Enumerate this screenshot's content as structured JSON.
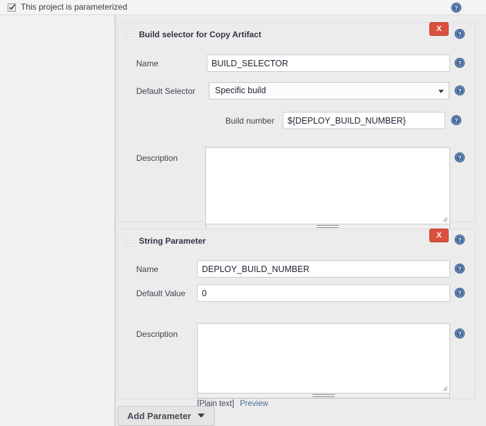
{
  "header": {
    "parameterized_label": "This project is parameterized",
    "checkbox_checked": true,
    "help_icon": "help-icon"
  },
  "colors": {
    "page_bg": "#ececec",
    "panel_bg": "#ececec",
    "panel_border": "#dddddd",
    "delete_button": "#d9503f",
    "help_icon_blue": "#3b5e91",
    "link_blue": "#4a6b9a",
    "input_bg": "#ffffff"
  },
  "panels": [
    {
      "title": "Build selector for Copy Artifact",
      "delete_label": "X",
      "drag_handle": "drag-handle-icon",
      "fields": [
        {
          "kind": "text",
          "label": "Name",
          "value": "BUILD_SELECTOR"
        },
        {
          "kind": "select",
          "label": "Default Selector",
          "value": "Specific build"
        },
        {
          "kind": "text",
          "label": "Build number",
          "value": "${DEPLOY_BUILD_NUMBER}"
        },
        {
          "kind": "textarea",
          "label": "Description",
          "value": ""
        }
      ]
    },
    {
      "title": "String Parameter",
      "delete_label": "X",
      "drag_handle": "drag-handle-icon",
      "fields": [
        {
          "kind": "text",
          "label": "Name",
          "value": "DEPLOY_BUILD_NUMBER"
        },
        {
          "kind": "text",
          "label": "Default Value",
          "value": "0"
        },
        {
          "kind": "textarea",
          "label": "Description",
          "value": ""
        }
      ],
      "markup_note": "[Plain text]",
      "preview_link": "Preview"
    }
  ],
  "footer": {
    "add_parameter_label": "Add Parameter",
    "caret_icon": "chevron-down-icon"
  }
}
